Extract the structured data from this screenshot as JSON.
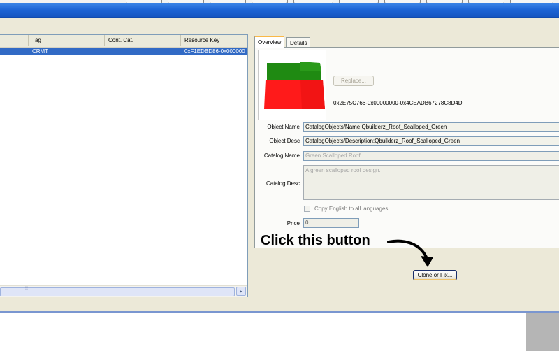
{
  "list": {
    "columns": [
      "",
      "Tag",
      "Cont. Cat.",
      "Resource Key"
    ],
    "rows": [
      [
        "",
        "CRMT",
        "",
        "0xF1EDBD86-0x000000"
      ]
    ]
  },
  "tabs": [
    {
      "label": "Overview",
      "active": true
    },
    {
      "label": "Details",
      "active": false
    }
  ],
  "overview": {
    "replace_label": "Replace...",
    "resource_key": "0x2E75C766-0x00000000-0x4CEADB67278C8D4D",
    "object_name_label": "Object Name",
    "object_name_value": "CatalogObjects/Name:Qbuilderz_Roof_Scalloped_Green",
    "object_desc_label": "Object Desc",
    "object_desc_value": "CatalogObjects/Description:Qbuilderz_Roof_Scalloped_Green",
    "catalog_name_label": "Catalog Name",
    "catalog_name_value": "Green Scalloped Roof",
    "catalog_desc_label": "Catalog Desc",
    "catalog_desc_value": "A green scalloped roof design.",
    "copy_english_label": "Copy English to all languages",
    "price_label": "Price",
    "price_value": "0",
    "clone_button_label": "Clone or Fix..."
  },
  "annotation": {
    "text": "Click this button"
  },
  "colors": {
    "titlebar": "#1d64d5",
    "selection": "#316ac5",
    "roof_green": "#1f8a12",
    "roof_red": "#ff1a1a"
  }
}
